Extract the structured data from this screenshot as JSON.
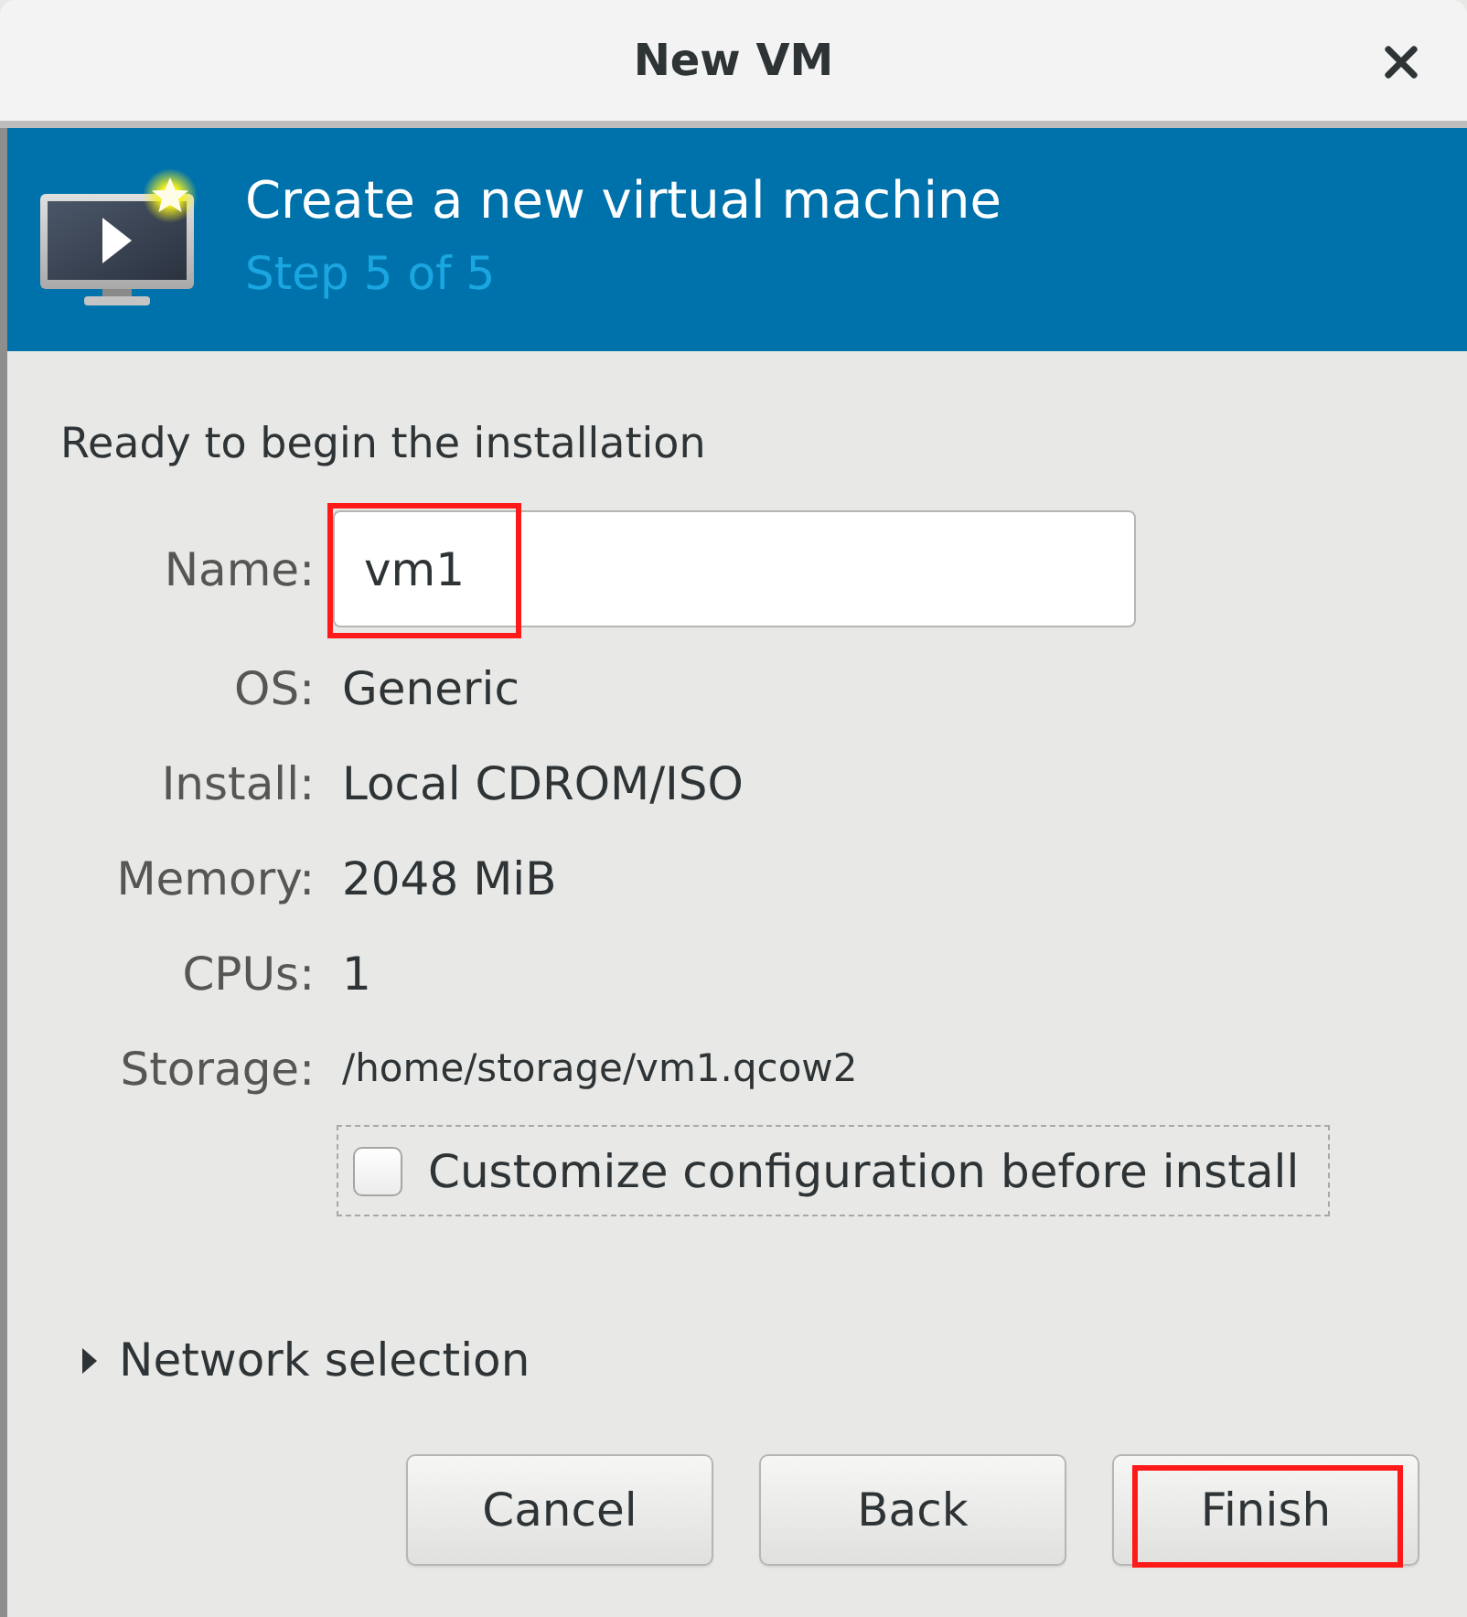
{
  "window": {
    "title": "New VM"
  },
  "header": {
    "title": "Create a new virtual machine",
    "step": "Step 5 of 5"
  },
  "summary": {
    "heading": "Ready to begin the installation",
    "fields": [
      {
        "label": "Name:",
        "kind": "entry",
        "value": "vm1",
        "highlighted": true
      },
      {
        "label": "OS:",
        "kind": "value",
        "value": "Generic"
      },
      {
        "label": "Install:",
        "kind": "value",
        "value": "Local CDROM/ISO"
      },
      {
        "label": "Memory:",
        "kind": "value",
        "value": "2048 MiB"
      },
      {
        "label": "CPUs:",
        "kind": "value",
        "value": "1"
      },
      {
        "label": "Storage:",
        "kind": "path",
        "value": "/home/storage/vm1.qcow2"
      }
    ]
  },
  "option": {
    "label": "Customize configuration before install",
    "checked": false,
    "focused": true
  },
  "expander": {
    "label": "Network selection",
    "expanded": false
  },
  "buttons": [
    {
      "label": "Cancel",
      "highlighted": false
    },
    {
      "label": "Back",
      "highlighted": false
    },
    {
      "label": "Finish",
      "highlighted": true
    }
  ]
}
